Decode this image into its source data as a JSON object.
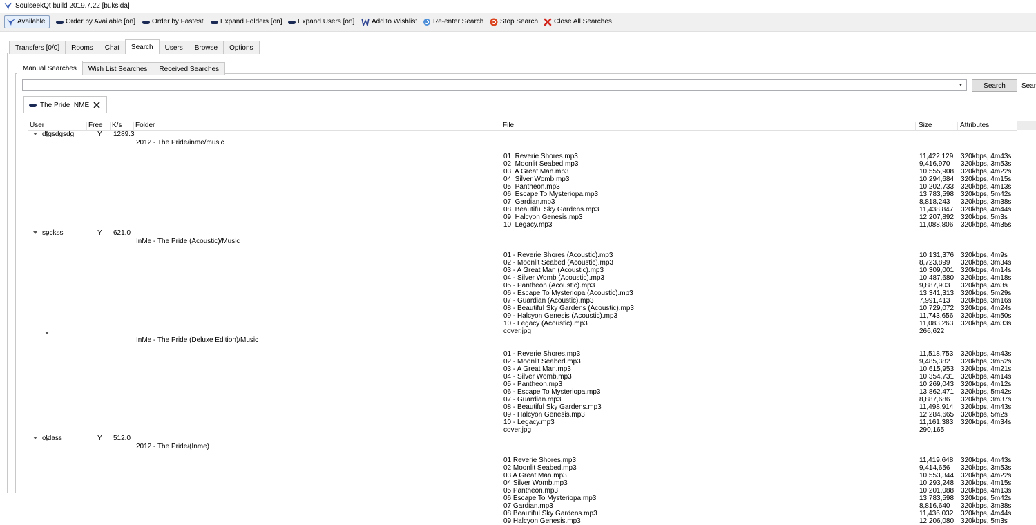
{
  "window": {
    "title": "SoulseekQt build 2019.7.22 [buksida]"
  },
  "toolbar": {
    "available": "Available",
    "order_available": "Order by Available [on]",
    "order_fastest": "Order by Fastest",
    "expand_folders": "Expand Folders [on]",
    "expand_users": "Expand Users [on]",
    "add_wishlist": "Add to Wishlist",
    "reenter": "Re-enter Search",
    "stop": "Stop Search",
    "close_all": "Close All Searches"
  },
  "main_tabs": [
    "Transfers [0/0]",
    "Rooms",
    "Chat",
    "Search",
    "Users",
    "Browse",
    "Options"
  ],
  "sub_tabs": [
    "Manual Searches",
    "Wish List Searches",
    "Received Searches"
  ],
  "search": {
    "value": "",
    "button": "Search",
    "cut_label": "Searc"
  },
  "result_tab": {
    "label": "The Pride INME"
  },
  "columns": {
    "user": "User",
    "free": "Free",
    "speed": "K/s",
    "folder": "Folder",
    "file": "File",
    "size": "Size",
    "attributes": "Attributes"
  },
  "users": [
    {
      "name": "dfgsdgsdg",
      "free": "Y",
      "speed": "1289.3",
      "folders": [
        {
          "path": "2012 - The Pride/inme/music",
          "files": [
            [
              "01. Reverie Shores.mp3",
              "11,422,129",
              "320kbps, 4m43s"
            ],
            [
              "02. Moonlit Seabed.mp3",
              "9,416,970",
              "320kbps, 3m53s"
            ],
            [
              "03. A Great Man.mp3",
              "10,555,908",
              "320kbps, 4m22s"
            ],
            [
              "04. Silver Womb.mp3",
              "10,294,684",
              "320kbps, 4m15s"
            ],
            [
              "05. Pantheon.mp3",
              "10,202,733",
              "320kbps, 4m13s"
            ],
            [
              "06. Escape To Mysteriopa.mp3",
              "13,783,598",
              "320kbps, 5m42s"
            ],
            [
              "07. Gardian.mp3",
              "8,818,243",
              "320kbps, 3m38s"
            ],
            [
              "08. Beautiful Sky Gardens.mp3",
              "11,438,847",
              "320kbps, 4m44s"
            ],
            [
              "09. Halcyon Genesis.mp3",
              "12,207,892",
              "320kbps, 5m3s"
            ],
            [
              "10. Legacy.mp3",
              "11,088,806",
              "320kbps, 4m35s"
            ]
          ]
        }
      ]
    },
    {
      "name": "sockss",
      "free": "Y",
      "speed": "621.0",
      "folders": [
        {
          "path": "InMe - The Pride (Acoustic)/Music",
          "files": [
            [
              "01 - Reverie Shores (Acoustic).mp3",
              "10,131,376",
              "320kbps, 4m9s"
            ],
            [
              "02 - Moonlit Seabed (Acoustic).mp3",
              "8,723,899",
              "320kbps, 3m34s"
            ],
            [
              "03 - A Great Man (Acoustic).mp3",
              "10,309,001",
              "320kbps, 4m14s"
            ],
            [
              "04 - Silver Womb (Acoustic).mp3",
              "10,487,680",
              "320kbps, 4m18s"
            ],
            [
              "05 - Pantheon (Acoustic).mp3",
              "9,887,903",
              "320kbps, 4m3s"
            ],
            [
              "06 - Escape To Mysteriopa (Acoustic).mp3",
              "13,341,313",
              "320kbps, 5m29s"
            ],
            [
              "07 - Guardian (Acoustic).mp3",
              "7,991,413",
              "320kbps, 3m16s"
            ],
            [
              "08 - Beautiful Sky Gardens (Acoustic).mp3",
              "10,729,072",
              "320kbps, 4m24s"
            ],
            [
              "09 - Halcyon Genesis (Acoustic).mp3",
              "11,743,656",
              "320kbps, 4m50s"
            ],
            [
              "10 - Legacy (Acoustic).mp3",
              "11,083,263",
              "320kbps, 4m33s"
            ],
            [
              "cover.jpg",
              "266,622",
              ""
            ]
          ]
        },
        {
          "path": "InMe - The Pride (Deluxe Edition)/Music",
          "files": [
            [
              "01 - Reverie Shores.mp3",
              "11,518,753",
              "320kbps, 4m43s"
            ],
            [
              "02 - Moonlit Seabed.mp3",
              "9,485,382",
              "320kbps, 3m52s"
            ],
            [
              "03 - A Great Man.mp3",
              "10,615,953",
              "320kbps, 4m21s"
            ],
            [
              "04 - Silver Womb.mp3",
              "10,354,731",
              "320kbps, 4m14s"
            ],
            [
              "05 - Pantheon.mp3",
              "10,269,043",
              "320kbps, 4m12s"
            ],
            [
              "06 - Escape To Mysteriopa.mp3",
              "13,862,471",
              "320kbps, 5m42s"
            ],
            [
              "07 - Guardian.mp3",
              "8,887,686",
              "320kbps, 3m37s"
            ],
            [
              "08 - Beautiful Sky Gardens.mp3",
              "11,498,914",
              "320kbps, 4m43s"
            ],
            [
              "09 - Halcyon Genesis.mp3",
              "12,284,665",
              "320kbps, 5m2s"
            ],
            [
              "10 - Legacy.mp3",
              "11,161,383",
              "320kbps, 4m34s"
            ],
            [
              "cover.jpg",
              "290,165",
              ""
            ]
          ]
        }
      ]
    },
    {
      "name": "oldass",
      "free": "Y",
      "speed": "512.0",
      "folders": [
        {
          "path": "2012 - The Pride/(Inme)",
          "files": [
            [
              "01 Reverie Shores.mp3",
              "11,419,648",
              "320kbps, 4m43s"
            ],
            [
              "02 Moonlit Seabed.mp3",
              "9,414,656",
              "320kbps, 3m53s"
            ],
            [
              "03 A Great Man.mp3",
              "10,553,344",
              "320kbps, 4m22s"
            ],
            [
              "04 Silver Womb.mp3",
              "10,293,248",
              "320kbps, 4m15s"
            ],
            [
              "05 Pantheon.mp3",
              "10,201,088",
              "320kbps, 4m13s"
            ],
            [
              "06 Escape To Mysteriopa.mp3",
              "13,783,598",
              "320kbps, 5m42s"
            ],
            [
              "07 Gardian.mp3",
              "8,816,640",
              "320kbps, 3m38s"
            ],
            [
              "08 Beautiful Sky Gardens.mp3",
              "11,436,032",
              "320kbps, 4m44s"
            ],
            [
              "09 Halcyon Genesis.mp3",
              "12,206,080",
              "320kbps, 5m3s"
            ]
          ]
        }
      ]
    }
  ]
}
